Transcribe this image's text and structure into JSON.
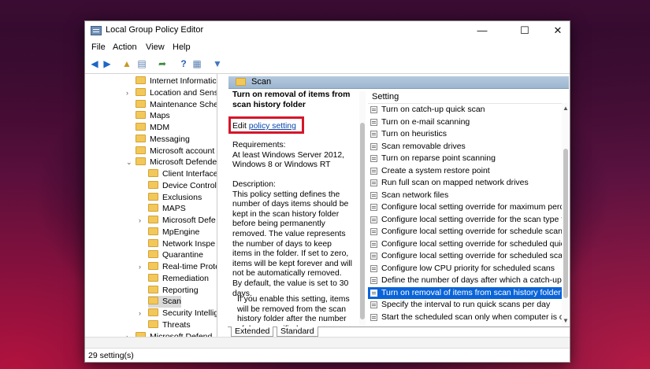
{
  "window": {
    "title": "Local Group Policy Editor",
    "minimize": "—",
    "maximize": "☐",
    "close": "✕"
  },
  "menu": [
    "File",
    "Action",
    "View",
    "Help"
  ],
  "tree": [
    {
      "label": "Internet Informatic",
      "expand": ""
    },
    {
      "label": "Location and Sensе",
      "expand": ">"
    },
    {
      "label": "Maintenance Sche",
      "expand": ""
    },
    {
      "label": "Maps",
      "expand": ""
    },
    {
      "label": "MDM",
      "expand": ""
    },
    {
      "label": "Messaging",
      "expand": ""
    },
    {
      "label": "Microsoft account",
      "expand": ""
    },
    {
      "label": "Microsoft Defende",
      "expand": "v"
    },
    {
      "label": "Client Interface",
      "expand": ""
    },
    {
      "label": "Device Control",
      "expand": ""
    },
    {
      "label": "Exclusions",
      "expand": ""
    },
    {
      "label": "MAPS",
      "expand": ""
    },
    {
      "label": "Microsoft Defe",
      "expand": ">"
    },
    {
      "label": "MpEngine",
      "expand": ""
    },
    {
      "label": "Network Inspe",
      "expand": ""
    },
    {
      "label": "Quarantine",
      "expand": ""
    },
    {
      "label": "Real-time Prote",
      "expand": ">"
    },
    {
      "label": "Remediation",
      "expand": ""
    },
    {
      "label": "Reporting",
      "expand": ""
    },
    {
      "label": "Scan",
      "expand": ""
    },
    {
      "label": "Security Intellig",
      "expand": ">"
    },
    {
      "label": "Threats",
      "expand": ""
    },
    {
      "label": "Microsoft Defend",
      "expand": ">"
    }
  ],
  "pane": {
    "header": "Scan",
    "ext_title": "Turn on removal of items from scan history folder",
    "edit_prefix": "Edit",
    "edit_link": "policy setting",
    "requirements_label": "Requirements:",
    "requirements": "At least Windows Server 2012, Windows 8 or Windows RT",
    "description_label": "Description:",
    "description": "This policy setting defines the number of days items should be kept in the scan history folder before being permanently removed. The value represents the number of days to keep items in the folder. If set to zero, items will be kept forever and will not be automatically removed. By default, the value is set to 30 days.",
    "description2": "If you enable this setting, items will be removed from the scan history folder after the number of days specified.",
    "column_header": "Setting",
    "settings": [
      "Turn on catch-up quick scan",
      "Turn on e-mail scanning",
      "Turn on heuristics",
      "Scan removable drives",
      "Turn on reparse point scanning",
      "Create a system restore point",
      "Run full scan on mapped network drives",
      "Scan network files",
      "Configure local setting override for maximum perce",
      "Configure local setting override for the scan type to",
      "Configure local setting override for schedule scan da",
      "Configure local setting override for scheduled quick",
      "Configure local setting override for scheduled scan t",
      "Configure low CPU priority for scheduled scans",
      "Define the number of days after which a catch-up sc",
      "Turn on removal of items from scan history folder",
      "Specify the interval to run quick scans per day",
      "Start the scheduled scan only when computer is on i"
    ],
    "selected_index": 15,
    "tabs": [
      "Extended",
      "Standard"
    ]
  },
  "status": "29 setting(s)",
  "colors": {
    "selection": "#0a64d8",
    "highlight_box": "#d5162a",
    "link": "#0645ad"
  }
}
